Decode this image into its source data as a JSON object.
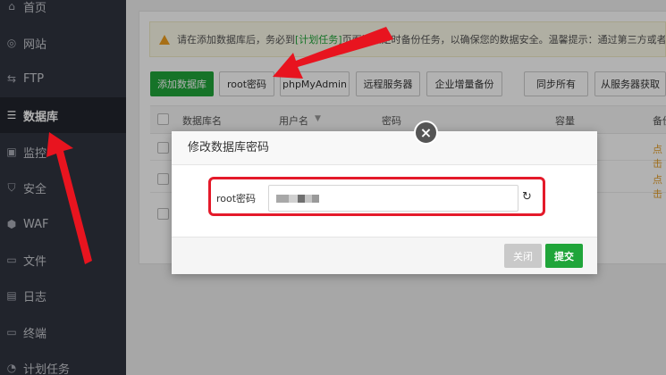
{
  "sidebar": {
    "items": [
      {
        "icon": "home-icon",
        "glyph": "⌂",
        "label": "首页"
      },
      {
        "icon": "globe-icon",
        "glyph": "◎",
        "label": "网站"
      },
      {
        "icon": "ftp-icon",
        "glyph": "⇆",
        "label": "FTP"
      },
      {
        "icon": "database-icon",
        "glyph": "☰",
        "label": "数据库"
      },
      {
        "icon": "monitor-icon",
        "glyph": "▣",
        "label": "监控"
      },
      {
        "icon": "shield-icon",
        "glyph": "⛉",
        "label": "安全"
      },
      {
        "icon": "waf-icon",
        "glyph": "⬢",
        "label": "WAF"
      },
      {
        "icon": "folder-icon",
        "glyph": "▭",
        "label": "文件"
      },
      {
        "icon": "log-icon",
        "glyph": "▤",
        "label": "日志"
      },
      {
        "icon": "terminal-icon",
        "glyph": "▭",
        "label": "终端"
      },
      {
        "icon": "cron-icon",
        "glyph": "◔",
        "label": "计划任务"
      }
    ]
  },
  "notice": {
    "before": "请在添加数据库后，务必到",
    "link": "[计划任务]",
    "after": "页面添加定时备份任务，以确保您的数据安全。温馨提示：通过第三方或者M"
  },
  "toolbar": {
    "add_db": "添加数据库",
    "root_password": "root密码",
    "phpmyadmin": "phpMyAdmin",
    "remote_server": "远程服务器",
    "incremental_backup": "企业增量备份",
    "sync_all": "同步所有",
    "fetch_from_server": "从服务器获取"
  },
  "table": {
    "headers": [
      "数据库名",
      "用户名",
      "密码",
      "容量",
      "备份"
    ],
    "row_action": "点击"
  },
  "modal": {
    "title": "修改数据库密码",
    "field_label": "root密码",
    "close_label": "关闭",
    "submit_label": "提交",
    "close_glyph": "×",
    "refresh_glyph": "↻"
  },
  "colors": {
    "sidebar_bg": "#30343f",
    "accent_green": "#20a53a",
    "highlight_red": "#e41a2a"
  }
}
